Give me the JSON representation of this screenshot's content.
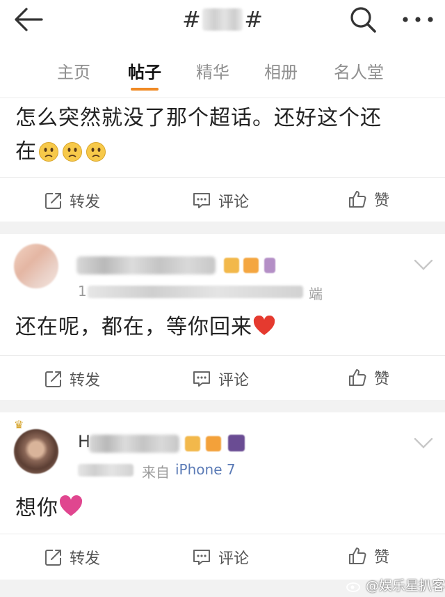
{
  "header": {
    "title_prefix": "#",
    "title_suffix": "#",
    "icons": {
      "back": "arrow-left-icon",
      "search": "search-icon",
      "more": "more-dots-icon"
    }
  },
  "tabs": [
    {
      "label": "主页"
    },
    {
      "label": "帖子",
      "active": true
    },
    {
      "label": "精华"
    },
    {
      "label": "相册"
    },
    {
      "label": "名人堂"
    }
  ],
  "accent_color": "#f08a24",
  "posts": [
    {
      "text_line1": "怎么突然就没了那个超话。还好这个还",
      "text_line2": "在",
      "emoji_count": 3
    },
    {
      "time_fragment": "1",
      "source_suffix": "端",
      "text": "还在呢，都在，等你回来",
      "heart_color": "#e53a2f"
    },
    {
      "name_initial": "H",
      "source_label": "来自",
      "device": "iPhone 7",
      "text": "想你",
      "heart_color": "#e0468f"
    }
  ],
  "actions": {
    "repost": "转发",
    "comment": "评论",
    "like": "赞"
  },
  "watermark": "@娱乐星扒客"
}
